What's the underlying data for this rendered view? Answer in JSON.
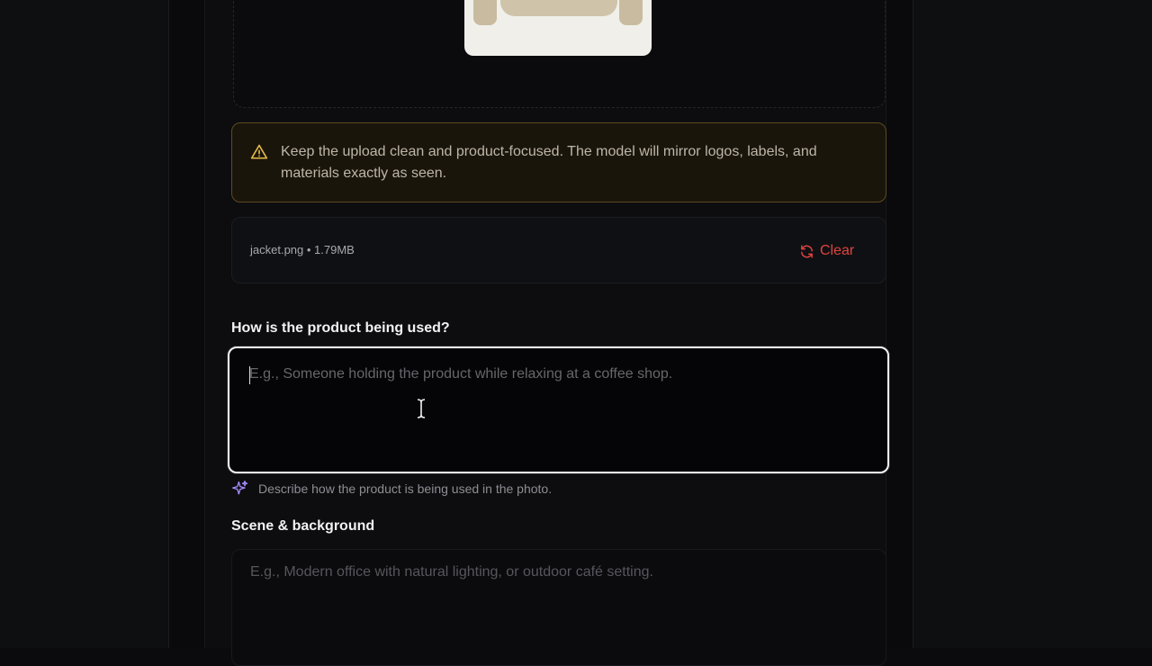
{
  "upload": {
    "image_alt": "jacket"
  },
  "warning": {
    "icon": "warning-triangle-icon",
    "text": "Keep the upload clean and product-focused. The model will mirror logos, labels, and materials exactly as seen.",
    "color": "#e0b84a"
  },
  "file": {
    "info": "jacket.png • 1.79MB",
    "clear_label": "Clear",
    "clear_icon": "refresh-icon",
    "clear_color": "#e0433f"
  },
  "usage": {
    "label": "How is the product being used?",
    "placeholder": "E.g., Someone holding the product while relaxing at a coffee shop.",
    "value": "",
    "hint": "Describe how the product is being used in the photo.",
    "hint_icon": "sparkle-icon"
  },
  "scene": {
    "label": "Scene & background",
    "placeholder": "E.g., Modern office with natural lighting, or outdoor café setting.",
    "value": ""
  }
}
